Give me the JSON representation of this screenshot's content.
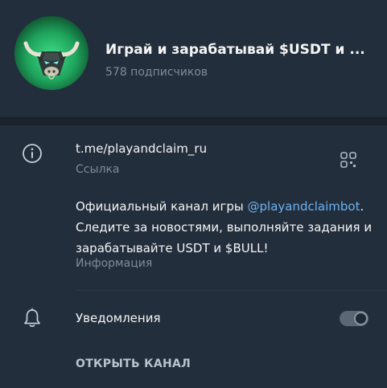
{
  "channel": {
    "title": "Играй и зарабатывай $USDT и ...",
    "subscribers": "578 подписчиков"
  },
  "link": {
    "url": "t.me/playandclaim_ru",
    "caption": "Ссылка"
  },
  "info": {
    "text_before": "Официальный канал игры ",
    "mention": "@playandclaimbot",
    "text_after": ". Следите за новостями, выполняйте задания и зарабатывайте USDT и $BULL!",
    "caption": "Информация"
  },
  "notifications": {
    "label": "Уведомления",
    "enabled": true
  },
  "open_channel_label": "ОТКРЫТЬ КАНАЛ",
  "colors": {
    "background": "#232e3c",
    "mention": "#6ab3f3",
    "secondary_text": "#7f8b98",
    "avatar_green": "#1fa35c"
  },
  "icons": {
    "info": "info-circle-icon",
    "qr": "qr-code-icon",
    "bell": "bell-icon"
  }
}
